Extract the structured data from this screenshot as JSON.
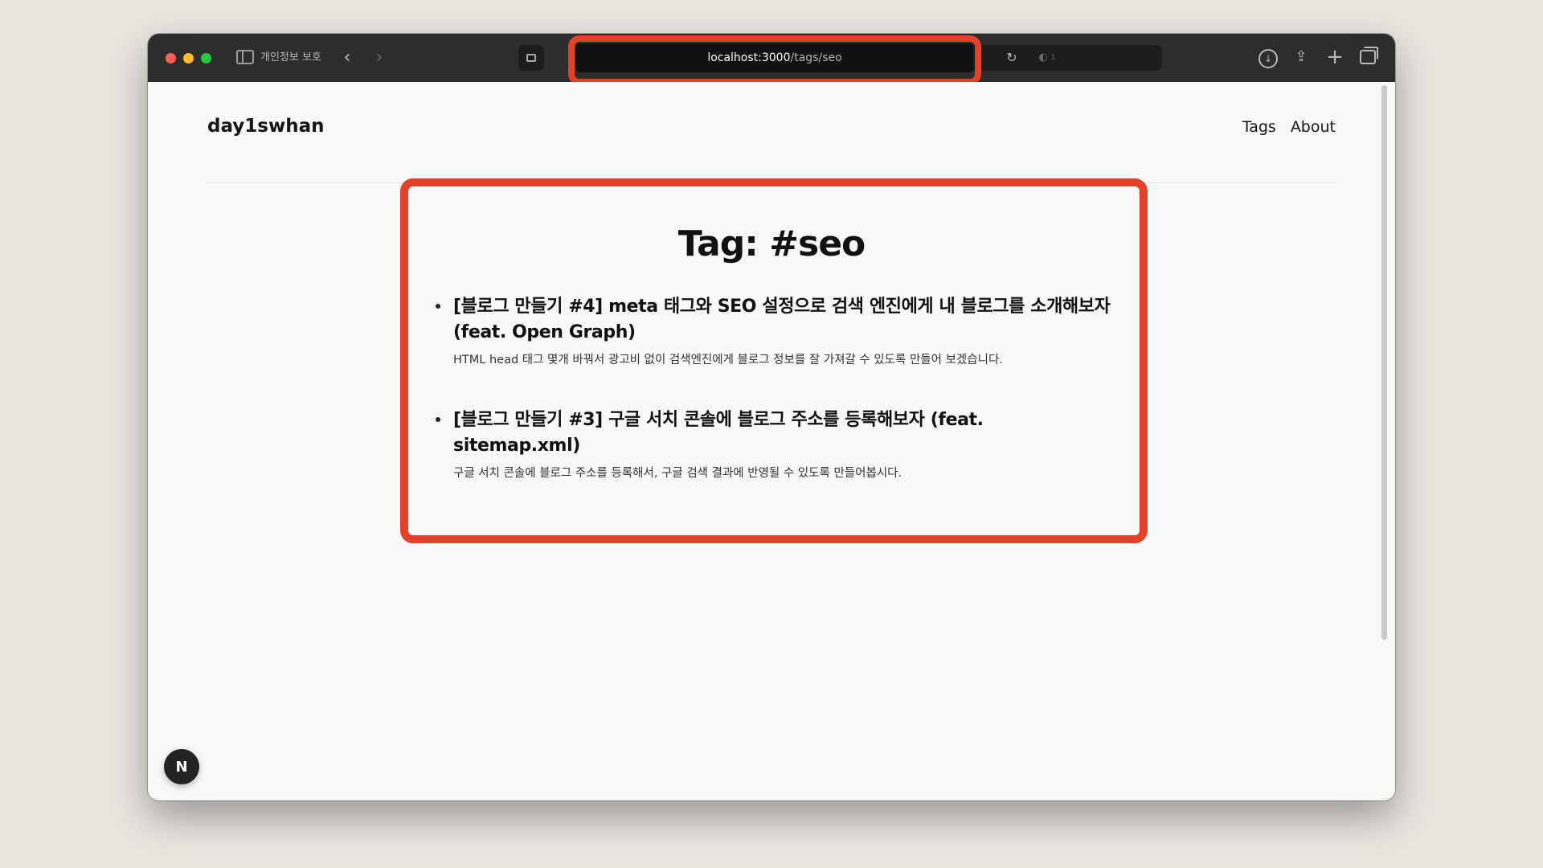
{
  "browser": {
    "privacy_label": "개인정보 보호",
    "url_host": "localhost:3000",
    "url_path": "/tags/seo",
    "shield_count": "1"
  },
  "site": {
    "logo": "day1swhan",
    "nav": [
      "Tags",
      "About"
    ]
  },
  "page": {
    "title": "Tag: #seo",
    "posts": [
      {
        "title": "[블로그 만들기 #4] meta 태그와 SEO 설정으로 검색 엔진에게 내 블로그를 소개해보자 (feat. Open Graph)",
        "description": "HTML head 태그 몇개 바꿔서 광고비 없이 검색엔진에게 블로그 정보를 잘 가져갈 수 있도록 만들어 보겠습니다."
      },
      {
        "title": "[블로그 만들기 #3] 구글 서치 콘솔에 블로그 주소를 등록해보자 (feat. sitemap.xml)",
        "description": "구글 서치 콘솔에 블로그 주소를 등록해서, 구글 검색 결과에 반영될 수 있도록 만들어봅시다."
      }
    ]
  },
  "devtools_badge": "N",
  "colors": {
    "highlight": "#e2412a",
    "titlebar": "#2e2d2d",
    "page_bg": "#f8f8f8"
  }
}
